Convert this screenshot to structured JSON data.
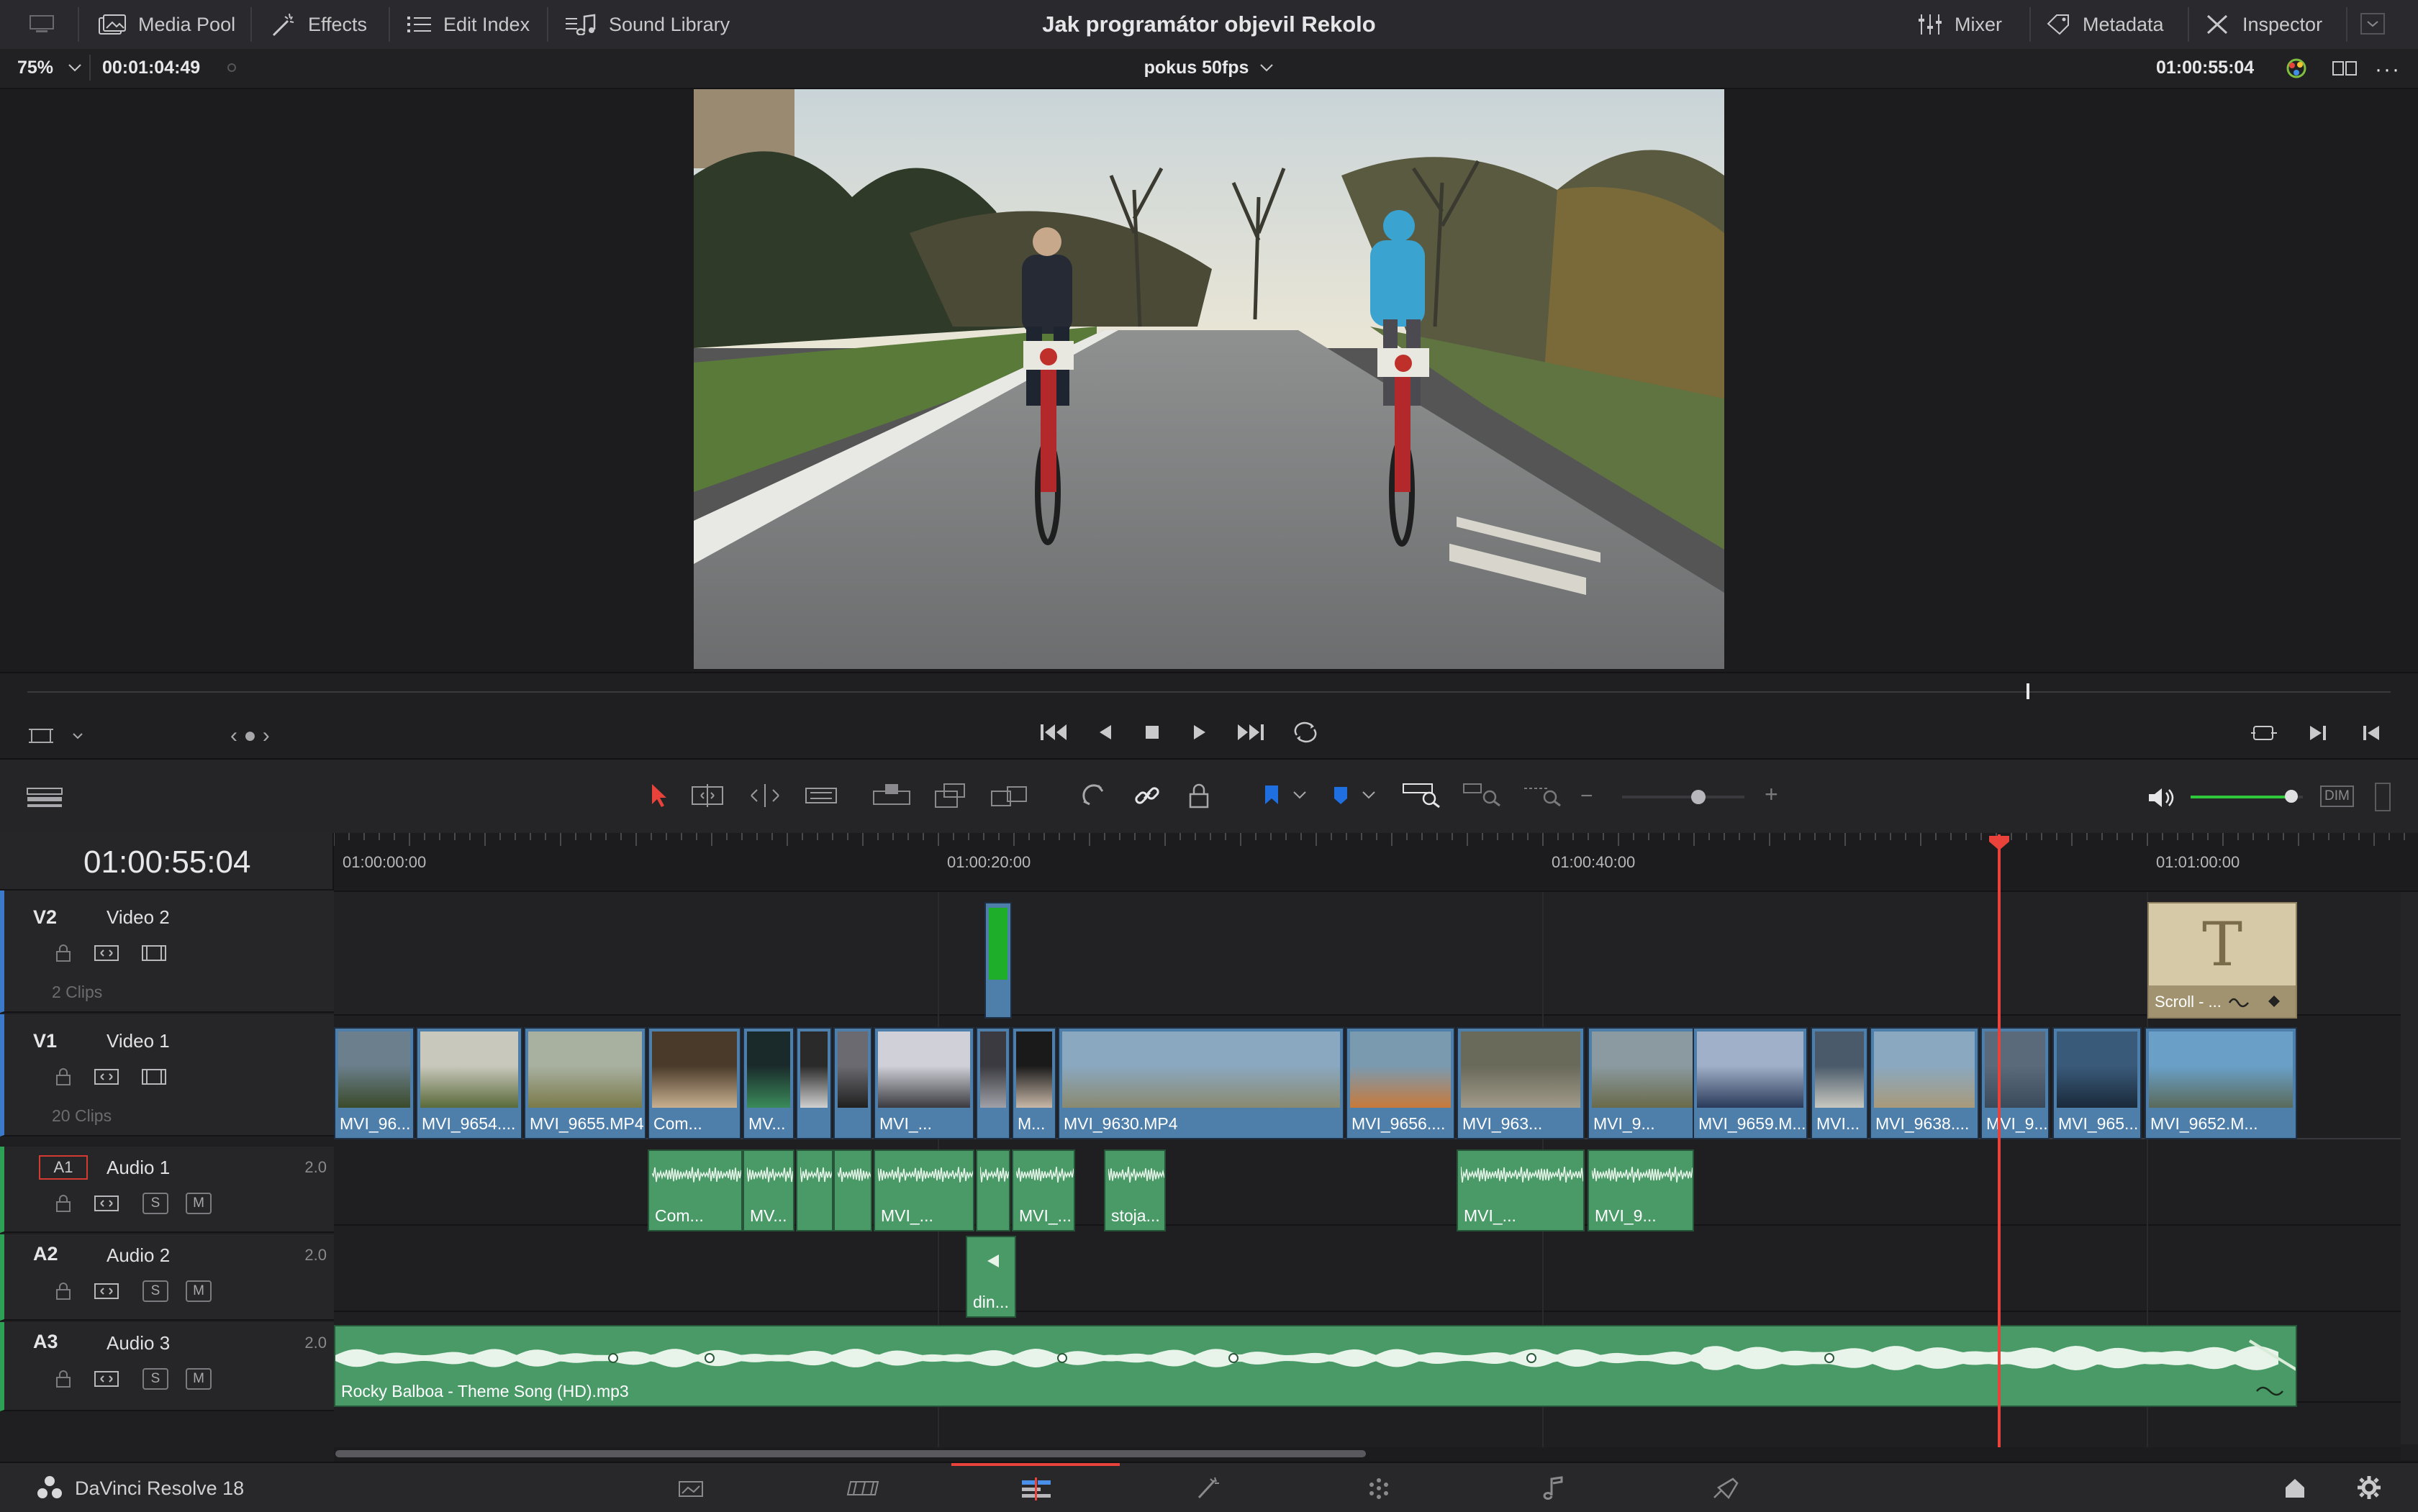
{
  "topbar": {
    "title": "Jak programátor objevil Rekolo",
    "media_pool": "Media Pool",
    "effects": "Effects",
    "edit_index": "Edit Index",
    "sound_library": "Sound Library",
    "mixer": "Mixer",
    "metadata": "Metadata",
    "inspector": "Inspector"
  },
  "viewer_bar": {
    "zoom": "75%",
    "source_tc": "00:01:04:49",
    "timeline_name": "pokus 50fps",
    "record_tc": "01:00:55:04"
  },
  "timeline": {
    "current_tc": "01:00:55:04",
    "ruler": [
      "01:00:00:00",
      "01:00:20:00",
      "01:00:40:00",
      "01:01:00:00"
    ],
    "tracks": {
      "v2": {
        "id": "V2",
        "name": "Video 2",
        "count": "2 Clips"
      },
      "v1": {
        "id": "V1",
        "name": "Video 1",
        "count": "20 Clips"
      },
      "a1": {
        "id": "A1",
        "name": "Audio 1",
        "ch": "2.0"
      },
      "a2": {
        "id": "A2",
        "name": "Audio 2",
        "ch": "2.0"
      },
      "a3": {
        "id": "A3",
        "name": "Audio 3",
        "ch": "2.0"
      }
    },
    "track_btn": {
      "solo": "S",
      "mute": "M"
    },
    "v2_title_clip": {
      "glyph": "T",
      "label": "Scroll - ..."
    },
    "v1_clips": [
      "MVI_96...",
      "MVI_9654....",
      "MVI_9655.MP4",
      "Com...",
      "MV...",
      "",
      "",
      "MVI_...",
      "",
      "M...",
      "MVI_9630.MP4",
      "MVI_9656....",
      "MVI_963...",
      "MVI_9...",
      "MVI_9659.M...",
      "MVI...",
      "MVI_9638....",
      "MVI_9...",
      "MVI_965...",
      "MVI_9652.M..."
    ],
    "a1_clips": [
      "Com...",
      "MV...",
      "",
      "",
      "MVI_...",
      "",
      "MVI_...",
      "stoja...",
      "MVI_...",
      "MVI_9..."
    ],
    "a2_clips": [
      "din..."
    ],
    "a3_clips": [
      "Rocky Balboa - Theme Song (HD).mp3"
    ]
  },
  "toolbar": {
    "dim": "DIM",
    "volume_level": 0.9
  },
  "footer": {
    "app_name": "DaVinci Resolve 18"
  },
  "colors": {
    "accent_red": "#e8423a",
    "clip_blue": "#4e7fab",
    "clip_green": "#4a9a68",
    "title_tan": "#d6c9a8"
  }
}
